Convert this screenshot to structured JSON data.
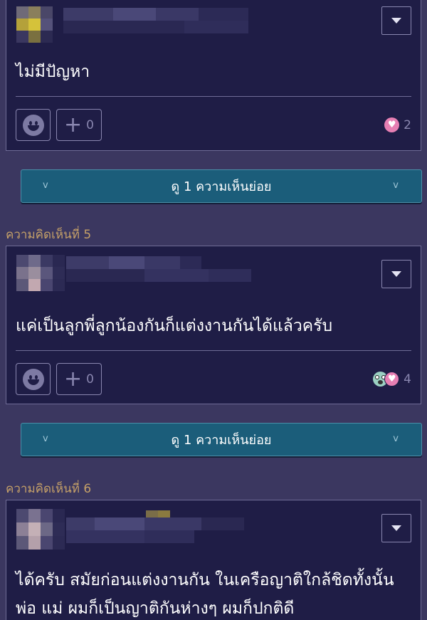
{
  "comments": [
    {
      "text": "ไม่มีปัญหา",
      "plus_count": "0",
      "reaction_count": "2",
      "reactions": [
        "heart-icon"
      ]
    },
    {
      "label": "ความคิดเห็นที่ 5",
      "text": "แค่เป็นลูกพี่ลูกน้องกันก็แต่งงานกันได้แล้วครับ",
      "plus_count": "0",
      "reaction_count": "4",
      "reactions": [
        "shocked-face-icon",
        "heart-icon"
      ]
    },
    {
      "label": "ความคิดเห็นที่ 6",
      "text_line1": "ได้ครับ สมัยก่อนแต่งงานกัน ในเครือญาติใกล้ชิดทั้งนั้น",
      "text_line2": "พ่อ แม่ ผมก็เป็นญาติกันห่างๆ ผมก็ปกติดี"
    }
  ],
  "sub_replies": [
    {
      "label": "ดู 1 ความเห็นย่อย",
      "chevron": "v"
    },
    {
      "label": "ดู 1 ความเห็นย่อย",
      "chevron": "v"
    }
  ],
  "colors": {
    "background": "#3b3760",
    "card": "#1f1d46",
    "sub_bar": "#1b5d7a",
    "section_label": "#c5a068",
    "heart": "#e67fb3"
  }
}
